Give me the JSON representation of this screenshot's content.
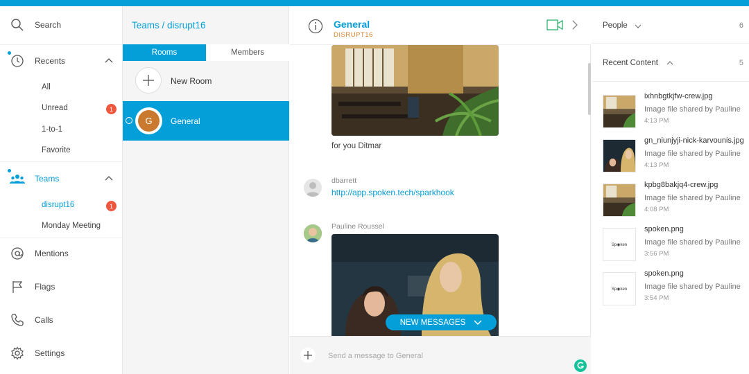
{
  "colors": {
    "accent": "#049fd9",
    "badge": "#f0563d",
    "video": "#3cb878",
    "room_sub": "#d9822b"
  },
  "nav": {
    "search": "Search",
    "recents": "Recents",
    "recents_sub": {
      "all": "All",
      "unread": "Unread",
      "unread_badge": "1",
      "one_to_one": "1-to-1",
      "favorite": "Favorite"
    },
    "teams": "Teams",
    "teams_sub": {
      "disrupt16": "disrupt16",
      "disrupt16_badge": "1",
      "monday": "Monday Meeting"
    },
    "mentions": "Mentions",
    "flags": "Flags",
    "calls": "Calls",
    "settings": "Settings"
  },
  "rooms": {
    "breadcrumb": "Teams / disrupt16",
    "tab_rooms": "Rooms",
    "tab_members": "Members",
    "new_room": "New Room",
    "general": "General",
    "general_initial": "G"
  },
  "convo": {
    "title": "General",
    "subtitle": "DISRUPT16",
    "caption": "for you Ditmar",
    "msg2_sender": "dbarrett",
    "msg2_link": "http://app.spoken.tech/sparkhook",
    "msg3_sender": "Pauline Roussel",
    "new_messages": "NEW MESSAGES",
    "compose_placeholder": "Send a message to General"
  },
  "right": {
    "people_label": "People",
    "people_count": "6",
    "recent_label": "Recent Content",
    "recent_count": "5",
    "files": [
      {
        "name": "ixhnbgtkjfw-crew.jpg",
        "meta": "Image file shared by Pauline",
        "time": "4:13 PM",
        "thumb": "photo-office"
      },
      {
        "name": "gn_niunjyji-nick-karvounis.jpg",
        "meta": "Image file shared by Pauline",
        "time": "4:13 PM",
        "thumb": "photo-people"
      },
      {
        "name": "kpbg8bakjq4-crew.jpg",
        "meta": "Image file shared by Pauline",
        "time": "4:08 PM",
        "thumb": "photo-office"
      },
      {
        "name": "spoken.png",
        "meta": "Image file shared by Pauline",
        "time": "3:56 PM",
        "thumb": "spoken-logo"
      },
      {
        "name": "spoken.png",
        "meta": "Image file shared by Pauline",
        "time": "3:54 PM",
        "thumb": "spoken-logo"
      }
    ],
    "logo_text": "Sp◉ken"
  }
}
